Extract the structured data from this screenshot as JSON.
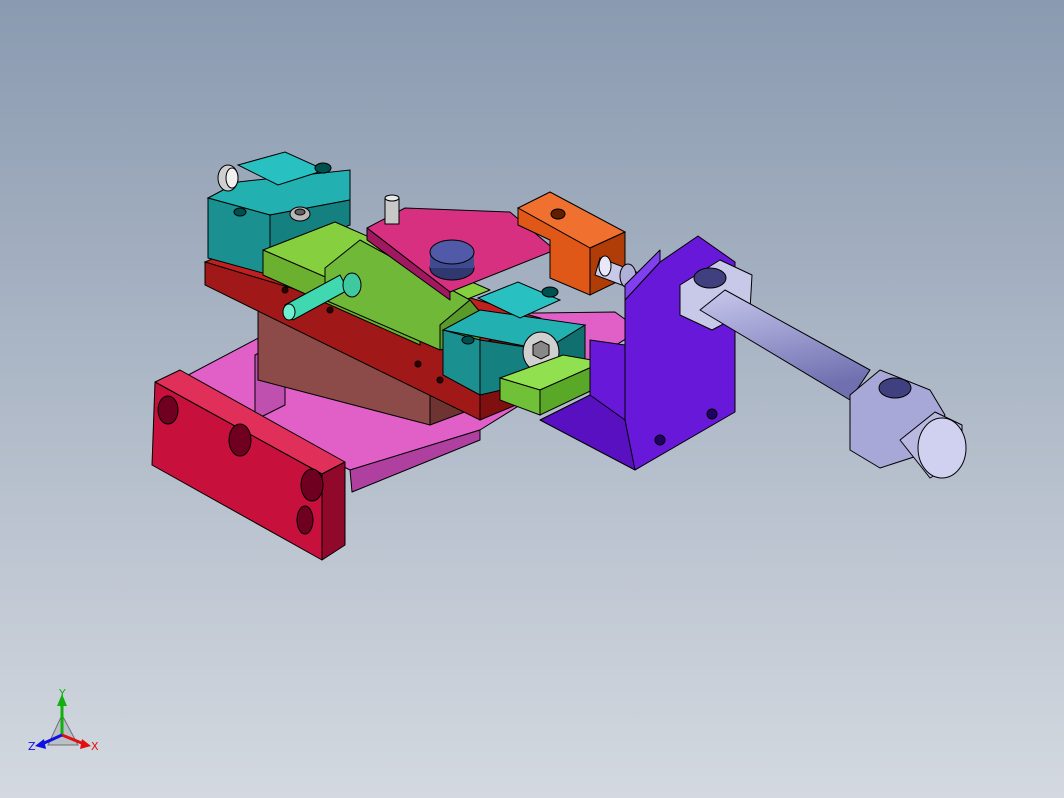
{
  "viewport": {
    "background_top": "#8a9ab0",
    "background_bottom": "#d4d9e0"
  },
  "model": {
    "parts": [
      "base-slide-plate",
      "end-bracket",
      "lower-mount-plate",
      "riser-block",
      "clamp-block-left",
      "clamp-block-right",
      "slider-block",
      "guide-pin",
      "cam-plate",
      "round-cap",
      "cylinder-bracket",
      "pneumatic-cylinder",
      "rod-end-block",
      "small-pin",
      "socket-head-screw"
    ],
    "colors": {
      "base": "#e060c8",
      "end_bracket": "#c8103c",
      "lower_plate": "#b01818",
      "riser": "#8c4a48",
      "clamp_block": "#1aa0a0",
      "slider": "#86d040",
      "cam_plate": "#d83080",
      "cap": "#404a90",
      "cylinder_bracket": "#6818d8",
      "cylinder": "#a8a8d8",
      "rod_block": "#e05818",
      "guide_pin": "#40d8b0"
    }
  },
  "triad": {
    "x_label": "X",
    "y_label": "Y",
    "z_label": "Z",
    "x_color": "#e01010",
    "y_color": "#10b010",
    "z_color": "#1010e0"
  }
}
